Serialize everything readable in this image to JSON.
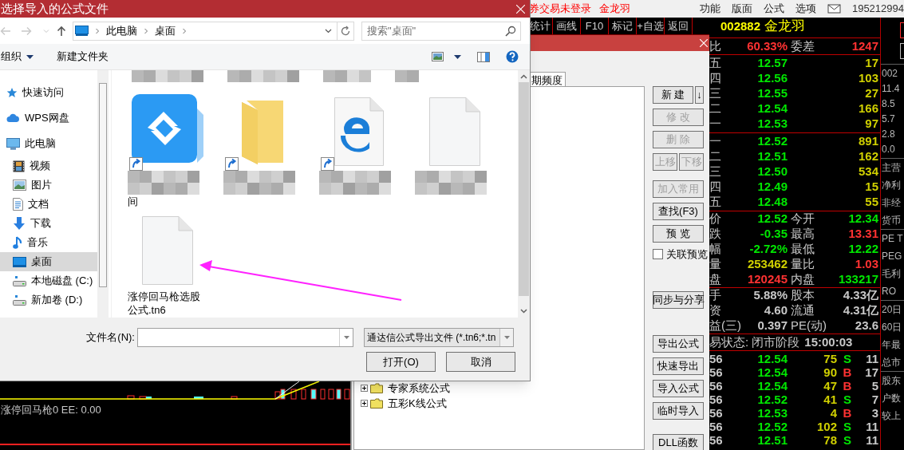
{
  "app_bar": {
    "status_text": "券交易未登录",
    "stock_name": "金龙羽",
    "menus": [
      "功能",
      "版面",
      "公式",
      "选项"
    ],
    "account": "195212994"
  },
  "quote_toolbar": [
    "统计",
    "画线",
    "F10",
    "标记",
    "+自选",
    "返回"
  ],
  "chart_panel": {
    "legend": "涨停回马枪0 EE: 0.00"
  },
  "formula_manager": {
    "tab": {
      "label": "期频度",
      "selected": true
    },
    "tree": [
      {
        "label": "专家系统公式",
        "expanded": false
      },
      {
        "label": "五彩K线公式",
        "expanded": false
      }
    ],
    "button_groups": [
      [
        {
          "kind": "split",
          "label": "新 建",
          "arrow": "↓",
          "disabled": false
        },
        {
          "kind": "button",
          "label": "修 改",
          "disabled": true
        },
        {
          "kind": "button",
          "label": "删 除",
          "disabled": true
        },
        {
          "kind": "pair",
          "label": "上移",
          "label2": "下移",
          "disabled": true
        }
      ],
      [
        {
          "kind": "button",
          "label": "加入常用",
          "disabled": true
        },
        {
          "kind": "button",
          "label": "查找(F3)",
          "disabled": false
        },
        {
          "kind": "button",
          "label": "预 览",
          "disabled": false
        },
        {
          "kind": "checkbox",
          "label": "关联预览",
          "checked": false
        }
      ],
      [
        {
          "kind": "button",
          "label": "同步与分享",
          "disabled": false
        }
      ],
      [
        {
          "kind": "button",
          "label": "导出公式",
          "disabled": false
        },
        {
          "kind": "button",
          "label": "快速导出",
          "disabled": false
        },
        {
          "kind": "button",
          "label": "导入公式",
          "disabled": false
        },
        {
          "kind": "button",
          "label": "临时导入",
          "disabled": false
        }
      ],
      [
        {
          "kind": "button",
          "label": "DLL函数",
          "disabled": false
        }
      ]
    ]
  },
  "quote": {
    "code": "002882",
    "name": "金龙羽",
    "ratio": [
      {
        "label": "比",
        "value": "60.33%",
        "color": "#ff3232"
      },
      {
        "label": "委差",
        "value": "1247",
        "color": "#ff3232"
      }
    ],
    "asks": [
      {
        "label": "五",
        "price": "12.57",
        "volume": "17"
      },
      {
        "label": "四",
        "price": "12.56",
        "volume": "103"
      },
      {
        "label": "三",
        "price": "12.55",
        "volume": "27"
      },
      {
        "label": "二",
        "price": "12.54",
        "volume": "166"
      },
      {
        "label": "一",
        "price": "12.53",
        "volume": "97"
      }
    ],
    "bids": [
      {
        "label": "一",
        "price": "12.52",
        "volume": "891"
      },
      {
        "label": "二",
        "price": "12.51",
        "volume": "162"
      },
      {
        "label": "三",
        "price": "12.50",
        "volume": "534"
      },
      {
        "label": "四",
        "price": "12.49",
        "volume": "15"
      },
      {
        "label": "五",
        "price": "12.48",
        "volume": "55"
      }
    ],
    "stats": [
      [
        {
          "label": "价",
          "value": "12.52",
          "color": "#00e600"
        },
        {
          "label": "今开",
          "value": "12.34",
          "color": "#00e600"
        }
      ],
      [
        {
          "label": "跌",
          "value": "-0.35",
          "color": "#00e600"
        },
        {
          "label": "最高",
          "value": "13.31",
          "color": "#ff3232"
        }
      ],
      [
        {
          "label": "幅",
          "value": "-2.72%",
          "color": "#00e600"
        },
        {
          "label": "最低",
          "value": "12.22",
          "color": "#00e600"
        }
      ],
      [
        {
          "label": "量",
          "value": "253462",
          "color": "#d0d000"
        },
        {
          "label": "量比",
          "value": "1.03",
          "color": "#ff3232"
        }
      ],
      [
        {
          "label": "盘",
          "value": "120245",
          "color": "#ff3232"
        },
        {
          "label": "内盘",
          "value": "133217",
          "color": "#00e600"
        }
      ]
    ],
    "finance": [
      [
        {
          "label": "手",
          "value": "5.88%",
          "color": "#c8c8c8"
        },
        {
          "label": "股本",
          "value": "4.33亿",
          "color": "#c8c8c8"
        }
      ],
      [
        {
          "label": "资",
          "value": "4.60",
          "color": "#c8c8c8"
        },
        {
          "label": "流通",
          "value": "4.31亿",
          "color": "#c8c8c8"
        }
      ],
      [
        {
          "label": "益(三)",
          "value": "0.397",
          "color": "#c8c8c8"
        },
        {
          "label": "PE(动)",
          "value": "23.6",
          "color": "#c8c8c8"
        }
      ]
    ],
    "status": {
      "label": "易状态: 闭市阶段",
      "time": "15:00:03"
    },
    "ticks": [
      {
        "time": "56",
        "price": "12.54",
        "volume": "75",
        "side": "S",
        "kind": "sell",
        "count": "11"
      },
      {
        "time": "56",
        "price": "12.54",
        "volume": "90",
        "side": "B",
        "kind": "buy",
        "count": "17"
      },
      {
        "time": "56",
        "price": "12.54",
        "volume": "47",
        "side": "B",
        "kind": "buy",
        "count": "5"
      },
      {
        "time": "56",
        "price": "12.52",
        "volume": "41",
        "side": "S",
        "kind": "sell",
        "count": "7"
      },
      {
        "time": "56",
        "price": "12.53",
        "volume": "4",
        "side": "B",
        "kind": "buy",
        "count": "3"
      },
      {
        "time": "56",
        "price": "12.52",
        "volume": "102",
        "side": "S",
        "kind": "sell",
        "count": "11"
      },
      {
        "time": "56",
        "price": "12.51",
        "volume": "78",
        "side": "S",
        "kind": "sell",
        "count": "11"
      }
    ]
  },
  "side_column": [
    [
      "002",
      "11.4",
      "8.5",
      "5.7",
      "2.8",
      "0.0"
    ],
    [
      "主营",
      "净利",
      "非经",
      "货币"
    ],
    [
      "PE T",
      "PEG",
      "毛利",
      "RO"
    ],
    [
      "20日",
      "60日",
      "年最",
      "总市"
    ],
    [
      "股东",
      "户数",
      "较上"
    ]
  ],
  "file_dialog": {
    "title": "选择导入的公式文件",
    "breadcrumb": [
      "此电脑",
      "桌面"
    ],
    "search_placeholder": "搜索\"桌面\"",
    "toolbar": {
      "organize": "组织",
      "new_folder": "新建文件夹"
    },
    "nav": [
      {
        "label": "快速访问",
        "kind": "star",
        "selected": false
      },
      {
        "label": "WPS网盘",
        "kind": "cloud",
        "selected": false
      },
      {
        "label": "此电脑",
        "kind": "pc",
        "selected": false,
        "children": [
          {
            "label": "视频",
            "kind": "video",
            "selected": false
          },
          {
            "label": "图片",
            "kind": "picture",
            "selected": false
          },
          {
            "label": "文档",
            "kind": "document",
            "selected": false
          },
          {
            "label": "下载",
            "kind": "download",
            "selected": false
          },
          {
            "label": "音乐",
            "kind": "music",
            "selected": false
          },
          {
            "label": "桌面",
            "kind": "desktop",
            "selected": true
          },
          {
            "label": "本地磁盘 (C:)",
            "kind": "drive",
            "selected": false
          },
          {
            "label": "新加卷 (D:)",
            "kind": "drive",
            "selected": false
          }
        ]
      }
    ],
    "files": [
      {
        "kind": "app",
        "shortcut": true,
        "name_blurred": true,
        "name": "间"
      },
      {
        "kind": "folder",
        "shortcut": true,
        "name_blurred": true
      },
      {
        "kind": "edge",
        "shortcut": true,
        "name_blurred": true
      },
      {
        "kind": "blank",
        "shortcut": false,
        "name_blurred": true
      },
      {
        "kind": "blank",
        "shortcut": false,
        "name_blurred": false,
        "name": "涨停回马枪选股公式.tn6"
      }
    ],
    "filename_label": "文件名(N):",
    "filter": "通达信公式导出文件 (*.tn6;*.tn",
    "buttons": [
      "打开(O)",
      "取消"
    ]
  }
}
